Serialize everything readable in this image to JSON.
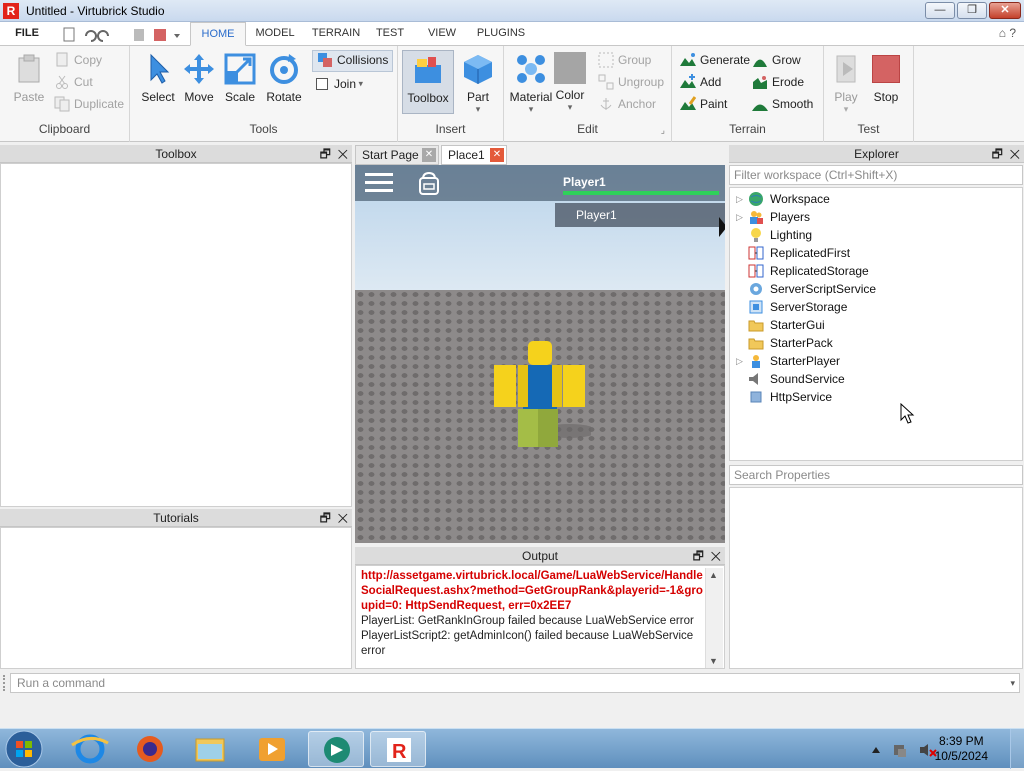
{
  "window": {
    "title": "Untitled - Virtubrick Studio",
    "min_label": "—",
    "max_label": "❐",
    "close_label": "✕"
  },
  "menu": {
    "tabs": [
      "FILE",
      "HOME",
      "MODEL",
      "TERRAIN",
      "TEST",
      "VIEW",
      "PLUGINS"
    ],
    "active": "HOME"
  },
  "ribbon": {
    "clipboard": {
      "label": "Clipboard",
      "paste": "Paste",
      "copy": "Copy",
      "cut": "Cut",
      "duplicate": "Duplicate"
    },
    "tools": {
      "label": "Tools",
      "select": "Select",
      "move": "Move",
      "scale": "Scale",
      "rotate": "Rotate",
      "collisions": "Collisions",
      "join": "Join"
    },
    "insert": {
      "label": "Insert",
      "toolbox": "Toolbox",
      "part": "Part"
    },
    "edit": {
      "label": "Edit",
      "material": "Material",
      "color": "Color",
      "group": "Group",
      "ungroup": "Ungroup",
      "anchor": "Anchor"
    },
    "terrain": {
      "label": "Terrain",
      "generate": "Generate",
      "add": "Add",
      "paint": "Paint",
      "grow": "Grow",
      "erode": "Erode",
      "smooth": "Smooth"
    },
    "test": {
      "label": "Test",
      "play": "Play",
      "stop": "Stop"
    }
  },
  "panels": {
    "toolbox": "Toolbox",
    "tutorials": "Tutorials",
    "output": "Output",
    "explorer": "Explorer",
    "float_icon": "🗗",
    "close_icon": "✕"
  },
  "doc_tabs": [
    {
      "label": "Start Page",
      "close": "✕"
    },
    {
      "label": "Place1",
      "close": "✕"
    }
  ],
  "viewport": {
    "player_name": "Player1",
    "player_health": 1.0,
    "playerlist_row": "Player1"
  },
  "output_lines": {
    "error": "http://assetgame.virtubrick.local/Game/LuaWebService/HandleSocialRequest.ashx?method=GetGroupRank&playerid=-1&groupid=0: HttpSendRequest, err=0x2EE7",
    "line2": "PlayerList: GetRankInGroup failed because LuaWebService error",
    "line3": "PlayerListScript2: getAdminIcon() failed because LuaWebService error"
  },
  "explorer": {
    "filter_placeholder": "Filter workspace (Ctrl+Shift+X)",
    "properties_placeholder": "Search Properties",
    "items": [
      "Workspace",
      "Players",
      "Lighting",
      "ReplicatedFirst",
      "ReplicatedStorage",
      "ServerScriptService",
      "ServerStorage",
      "StarterGui",
      "StarterPack",
      "StarterPlayer",
      "SoundService",
      "HttpService"
    ]
  },
  "command_bar": {
    "placeholder": "Run a command"
  },
  "taskbar": {
    "time": "8:39 PM",
    "date": "10/5/2024"
  },
  "colors": {
    "accent": "#2a6ccb",
    "error": "#d50000",
    "stop": "#d46363",
    "close": "#e45a3a"
  }
}
